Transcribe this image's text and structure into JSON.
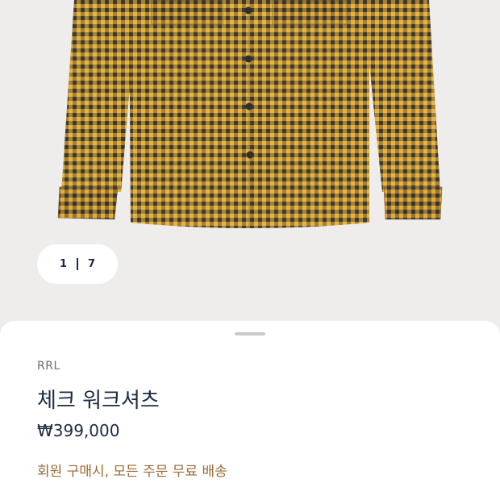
{
  "product_image": {
    "description_icon": "plaid-shirt-image",
    "colors": {
      "check_light": "#e8b53c",
      "check_dark": "#4d4536",
      "button": "#2a2f38"
    }
  },
  "pager": {
    "current": "1",
    "total": "7"
  },
  "product": {
    "brand": "RRL",
    "name": "체크 워크셔츠",
    "price": "₩399,000",
    "promo": "회원 구매시, 모든 주문 무료 배송"
  },
  "colors": {
    "navy": "#1c2a44",
    "promo": "#9a6a35",
    "background": "#efedeb"
  }
}
